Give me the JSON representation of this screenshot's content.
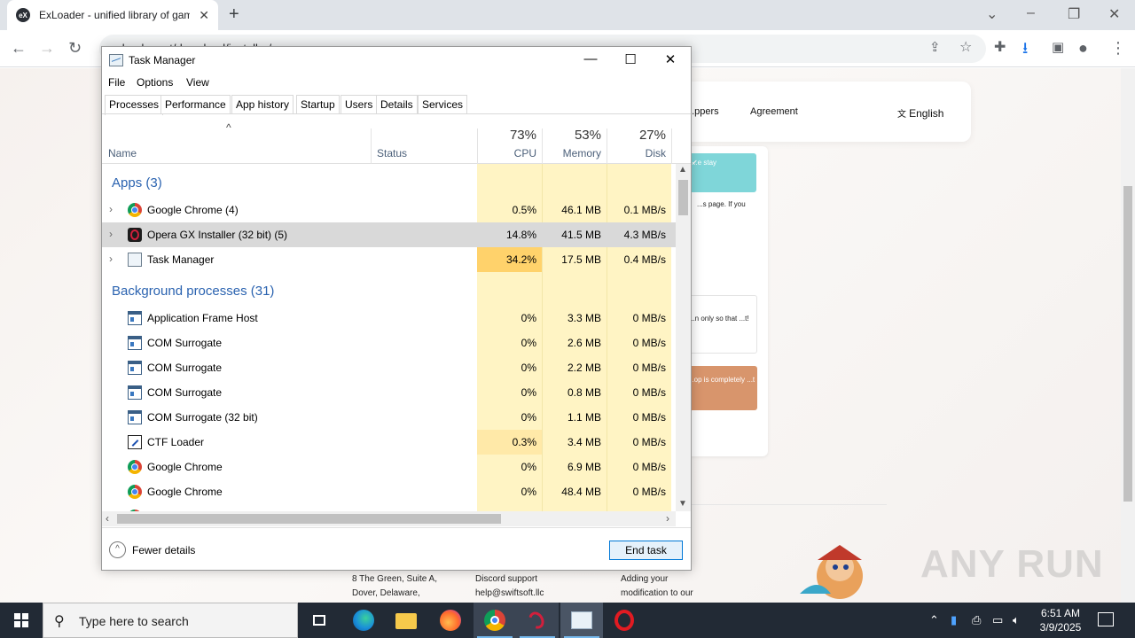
{
  "browser": {
    "tab_title": "ExLoader - unified library of game...",
    "favicon_text": "eX",
    "new_tab": "+",
    "url": "exloader.net/download/installer/"
  },
  "site": {
    "nav": {
      "item1": "...ppers",
      "item2": "Agreement",
      "lang": "English"
    },
    "card_teal": "...e stay",
    "card_text1": "...s page. If you",
    "card_box_text": "...n only so that ...t!",
    "card_orange": "...op is completely ...t",
    "footer": {
      "address": "8 The Green, Suite A, Dover, Delaware,",
      "support": "Discord support help@swiftsoft.llc",
      "note": "Adding your modification to our"
    },
    "watermark": "ANY RUN"
  },
  "task_manager": {
    "title": "Task Manager",
    "menu": [
      "File",
      "Options",
      "View"
    ],
    "tabs": [
      "Processes",
      "Performance",
      "App history",
      "Startup",
      "Users",
      "Details",
      "Services"
    ],
    "active_tab": "Processes",
    "columns": {
      "name": "Name",
      "status": "Status",
      "cpu_pct": "73%",
      "cpu": "CPU",
      "mem_pct": "53%",
      "mem": "Memory",
      "disk_pct": "27%",
      "disk": "Disk"
    },
    "apps_group": "Apps (3)",
    "apps": [
      {
        "name": "Google Chrome (4)",
        "cpu": "0.5%",
        "mem": "46.1 MB",
        "disk": "0.1 MB/s",
        "icon": "chrome-icon"
      },
      {
        "name": "Opera GX Installer (32 bit) (5)",
        "cpu": "14.8%",
        "mem": "41.5 MB",
        "disk": "4.3 MB/s",
        "icon": "opera-gx-icon"
      },
      {
        "name": "Task Manager",
        "cpu": "34.2%",
        "mem": "17.5 MB",
        "disk": "0.4 MB/s",
        "icon": "task-manager-icon"
      }
    ],
    "bg_group": "Background processes (31)",
    "background": [
      {
        "name": "Application Frame Host",
        "cpu": "0%",
        "mem": "3.3 MB",
        "disk": "0 MB/s",
        "icon": "window-icon"
      },
      {
        "name": "COM Surrogate",
        "cpu": "0%",
        "mem": "2.6 MB",
        "disk": "0 MB/s",
        "icon": "window-icon"
      },
      {
        "name": "COM Surrogate",
        "cpu": "0%",
        "mem": "2.2 MB",
        "disk": "0 MB/s",
        "icon": "window-icon"
      },
      {
        "name": "COM Surrogate",
        "cpu": "0%",
        "mem": "0.8 MB",
        "disk": "0 MB/s",
        "icon": "window-icon"
      },
      {
        "name": "COM Surrogate (32 bit)",
        "cpu": "0%",
        "mem": "1.1 MB",
        "disk": "0 MB/s",
        "icon": "window-icon"
      },
      {
        "name": "CTF Loader",
        "cpu": "0.3%",
        "mem": "3.4 MB",
        "disk": "0 MB/s",
        "icon": "ctf-loader-icon"
      },
      {
        "name": "Google Chrome",
        "cpu": "0%",
        "mem": "6.9 MB",
        "disk": "0 MB/s",
        "icon": "chrome-icon"
      },
      {
        "name": "Google Chrome",
        "cpu": "0%",
        "mem": "48.4 MB",
        "disk": "0 MB/s",
        "icon": "chrome-icon"
      }
    ],
    "fewer_details": "Fewer details",
    "end_task": "End task",
    "colors": {
      "cpu_high": "#ffd26b",
      "cell": "#fff4c4",
      "cpu_mid": "#ffe9a8",
      "group": "#2b63b0"
    }
  },
  "taskbar": {
    "search_placeholder": "Type here to search",
    "time": "6:51 AM",
    "date": "3/9/2025",
    "apps": [
      "task-view-icon",
      "edge-icon",
      "file-explorer-icon",
      "firefox-icon",
      "chrome-icon",
      "opera-gx-icon",
      "task-manager-icon",
      "opera-icon"
    ]
  }
}
